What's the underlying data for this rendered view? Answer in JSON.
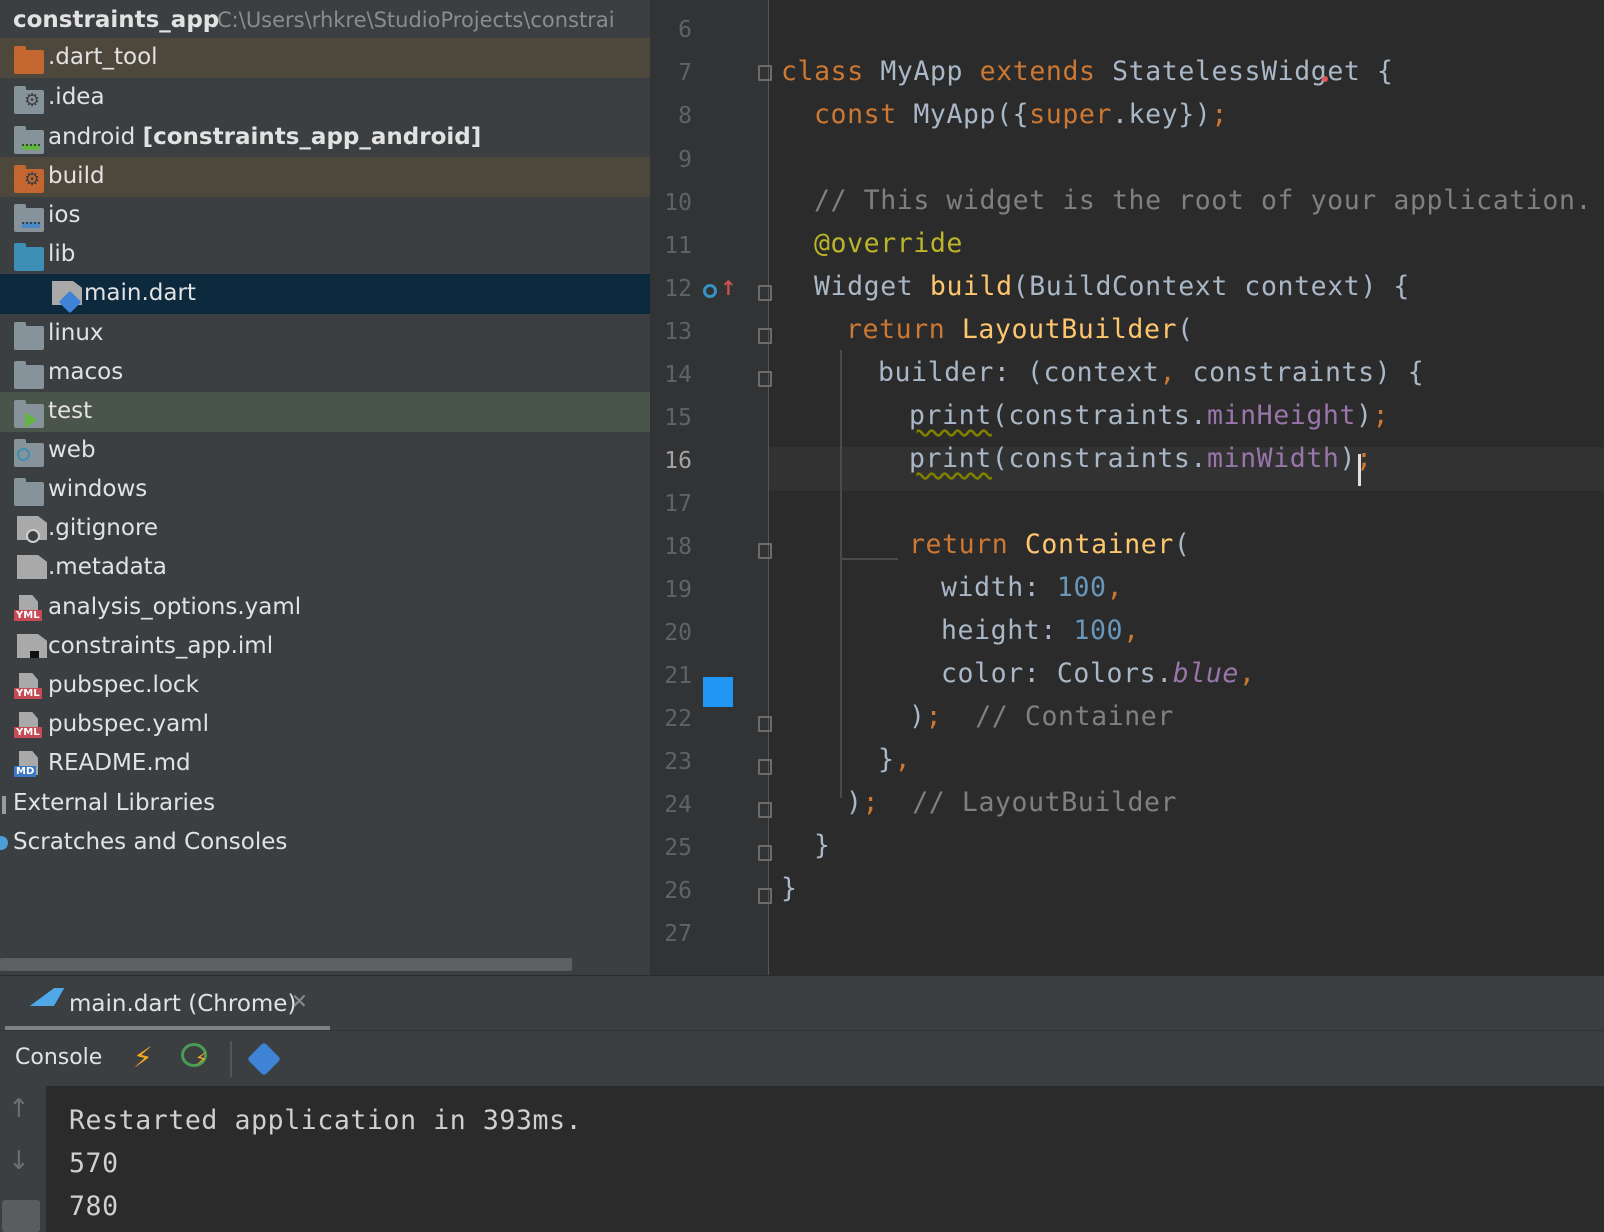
{
  "project": {
    "root_name": "constraints_app",
    "root_path": "C:\\Users\\rhkre\\StudioProjects\\constrai",
    "items": [
      {
        "label": ".dart_tool",
        "kind": "folder-orange"
      },
      {
        "label": ".idea",
        "kind": "folder-config"
      },
      {
        "label": "android",
        "suffix": "[constraints_app_android]",
        "kind": "folder-module"
      },
      {
        "label": "build",
        "kind": "folder-orange-config"
      },
      {
        "label": "ios",
        "kind": "folder-module"
      },
      {
        "label": "lib",
        "kind": "folder-source"
      },
      {
        "label": "main.dart",
        "kind": "dart-file"
      },
      {
        "label": "linux",
        "kind": "folder"
      },
      {
        "label": "macos",
        "kind": "folder"
      },
      {
        "label": "test",
        "kind": "folder-test"
      },
      {
        "label": "web",
        "kind": "folder-web"
      },
      {
        "label": "windows",
        "kind": "folder"
      },
      {
        "label": ".gitignore",
        "kind": "file-ignore"
      },
      {
        "label": ".metadata",
        "kind": "file-text"
      },
      {
        "label": "analysis_options.yaml",
        "kind": "file-yaml"
      },
      {
        "label": "constraints_app.iml",
        "kind": "file-iml"
      },
      {
        "label": "pubspec.lock",
        "kind": "file-yaml"
      },
      {
        "label": "pubspec.yaml",
        "kind": "file-yaml"
      },
      {
        "label": "README.md",
        "kind": "file-md"
      }
    ],
    "external_libraries": "External Libraries",
    "scratches": "Scratches and Consoles",
    "yml_badge": "YML",
    "md_badge": "MD"
  },
  "editor": {
    "line_numbers": [
      "6",
      "7",
      "8",
      "9",
      "10",
      "11",
      "12",
      "13",
      "14",
      "15",
      "16",
      "17",
      "18",
      "19",
      "20",
      "21",
      "22",
      "23",
      "24",
      "25",
      "26",
      "27"
    ],
    "current_line": "16",
    "lines": {
      "l7": {
        "a": "class",
        "b": " MyApp ",
        "c": "extends",
        "d": " StatelessWidget {"
      },
      "l8": {
        "a": "const",
        "b": " MyApp({",
        "c": "super",
        "d": ".key})",
        "e": ";"
      },
      "l10": {
        "a": "// This widget is the root of your application."
      },
      "l11": {
        "a": "@override"
      },
      "l12": {
        "a": "Widget ",
        "b": "build",
        "c": "(BuildContext context) {"
      },
      "l13": {
        "a": "return",
        "b": " LayoutBuilder",
        "c": "("
      },
      "l14": {
        "a": "builder: (context",
        "b": ",",
        "c": " constraints) {"
      },
      "l15": {
        "a": "print",
        "b": "(constraints.",
        "c": "minHeight",
        "d": ")",
        "e": ";"
      },
      "l16": {
        "a": "print",
        "b": "(constraints.",
        "c": "minWidth",
        "d": ")",
        "e": ";"
      },
      "l18": {
        "a": "return",
        "b": " Container",
        "c": "("
      },
      "l19": {
        "a": "width: ",
        "b": "100",
        "c": ","
      },
      "l20": {
        "a": "height: ",
        "b": "100",
        "c": ","
      },
      "l21": {
        "a": "color: Colors.",
        "b": "blue",
        "c": ","
      },
      "l22": {
        "a": ")",
        "b": ";",
        "c": "  // Container"
      },
      "l23": {
        "a": "}",
        "b": ","
      },
      "l24": {
        "a": ")",
        "b": ";",
        "c": "  // LayoutBuilder"
      },
      "l25": {
        "a": "}"
      },
      "l26": {
        "a": "}"
      }
    },
    "swatch_color": "#2196f3"
  },
  "run": {
    "tab_label": "main.dart (Chrome)",
    "close_glyph": "✕",
    "console_label": "Console",
    "output": [
      "Restarted application in 393ms.",
      "570",
      "780"
    ]
  },
  "colors": {
    "accent_blue": "#2196f3",
    "hot_reload": "#f5a623",
    "restart_green": "#499c54"
  }
}
